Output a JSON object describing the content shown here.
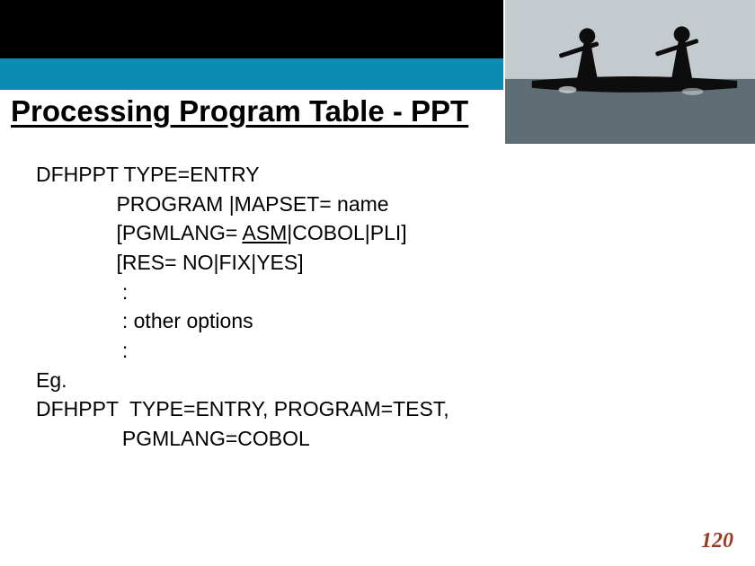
{
  "title": "Processing Program Table - PPT",
  "content": {
    "l1": "DFHPPT TYPE=ENTRY",
    "l2": "              PROGRAM |MAPSET= name",
    "l3a": "              [PGMLANG= ",
    "l3u": "ASM",
    "l3b": "|COBOL|PLI]",
    "l4": "              [RES= NO|FIX|YES]",
    "l5": "               :",
    "l6": "               : other options",
    "l7": "               :",
    "l8": "Eg.",
    "l9": "DFHPPT  TYPE=ENTRY, PROGRAM=TEST,",
    "l10": "               PGMLANG=COBOL"
  },
  "page_number": "120"
}
